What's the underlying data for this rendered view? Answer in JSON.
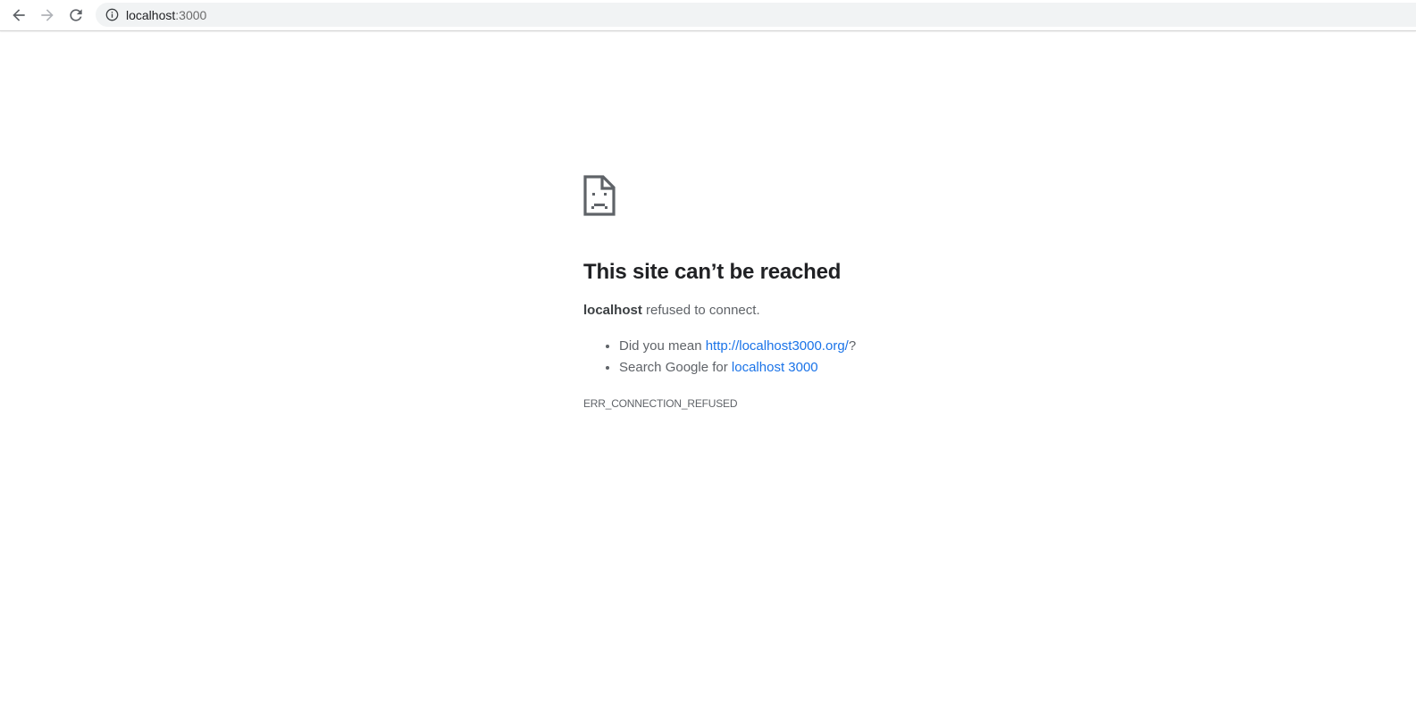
{
  "browser": {
    "back_icon": "arrow-left-icon",
    "forward_icon": "arrow-right-icon",
    "reload_icon": "reload-icon",
    "info_icon": "info-icon",
    "url_host": "localhost",
    "url_port": ":3000"
  },
  "error_page": {
    "icon": "sad-document-icon",
    "title": "This site can’t be reached",
    "host": "localhost",
    "message": " refused to connect.",
    "suggestions": [
      {
        "prefix": "Did you mean ",
        "link_text": "http://localhost3000.org/",
        "suffix": "?"
      },
      {
        "prefix": "Search Google for ",
        "link_text": "localhost 3000",
        "suffix": ""
      }
    ],
    "error_code": "ERR_CONNECTION_REFUSED"
  },
  "colors": {
    "link": "#1a73e8",
    "text": "#5f6368",
    "title": "#202124",
    "omnibox_bg": "#f1f3f4"
  }
}
